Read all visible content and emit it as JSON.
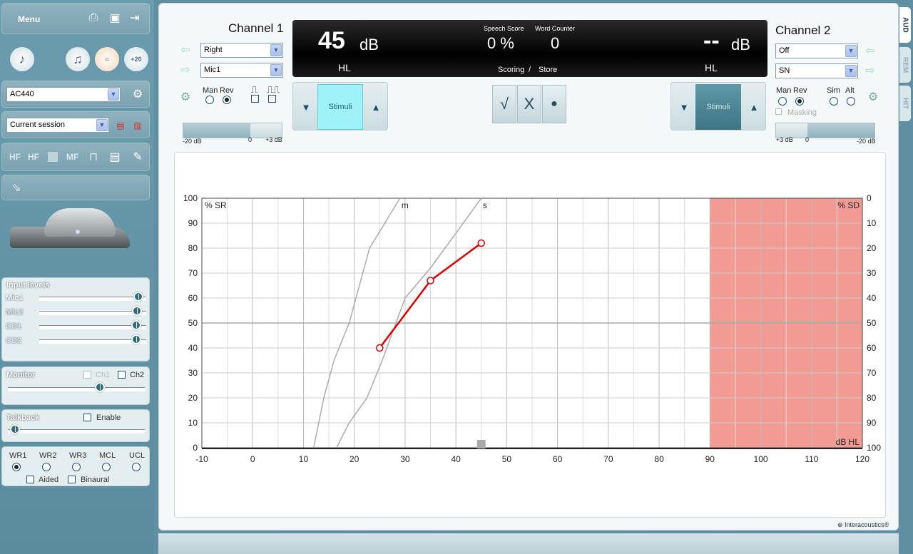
{
  "sidebar": {
    "menu_label": "Menu",
    "transducer": "AC440",
    "session": "Current session",
    "toolbar_labels": [
      "HF",
      "HF",
      "MF"
    ],
    "input_levels": {
      "title": "Input levels",
      "items": [
        {
          "label": "Mic1",
          "level": 0.97
        },
        {
          "label": "Mic2",
          "level": 0.96
        },
        {
          "label": "CD1",
          "level": 0.95
        },
        {
          "label": "CD2",
          "level": 0.95
        }
      ]
    },
    "monitor": {
      "title": "Monitor",
      "ch1": "Ch1",
      "ch2": "Ch2",
      "level": 0.67
    },
    "talkback": {
      "title": "Talkback",
      "enable": "Enable",
      "level": 0.05
    },
    "word_lists": [
      {
        "label": "WR1",
        "selected": true
      },
      {
        "label": "WR2",
        "selected": false
      },
      {
        "label": "WR3",
        "selected": false
      },
      {
        "label": "MCL",
        "selected": false
      },
      {
        "label": "UCL",
        "selected": false
      }
    ],
    "aided": "Aided",
    "binaural": "Binaural"
  },
  "channel1": {
    "title": "Channel 1",
    "output": "Right",
    "input": "Mic1",
    "man": "Man",
    "rev": "Rev",
    "intensity": "45",
    "unit": "dB",
    "hl": "HL",
    "stimuli": "Stimuli",
    "scale": [
      "-20 dB",
      "0",
      "+3 dB"
    ]
  },
  "channel2": {
    "title": "Channel 2",
    "output": "Off",
    "input": "SN",
    "man": "Man",
    "rev": "Rev",
    "sim": "Sim",
    "alt": "Alt",
    "masking": "Masking",
    "intensity": "--",
    "unit": "dB",
    "hl": "HL",
    "stimuli": "Stimuli",
    "scale": [
      "+3 dB",
      "0",
      "-20 dB"
    ]
  },
  "display": {
    "speech_score_label": "Speech Score",
    "speech_score": "0 %",
    "word_counter_label": "Word Counter",
    "word_counter": "0",
    "scoring": "Scoring",
    "slash": "/",
    "store": "Store"
  },
  "score_buttons": {
    "correct": "√",
    "incorrect": "X",
    "record": "●"
  },
  "right_tabs": [
    {
      "label": "AUD",
      "active": true
    },
    {
      "label": "REM",
      "active": false
    },
    {
      "label": "HIT",
      "active": false
    }
  ],
  "brand": "Interacoustics®",
  "colors": {
    "accent": "#5f8fa0",
    "curve": "#e00000",
    "shaded": "#f29b95",
    "stimuli_active": "#9ff2f8"
  },
  "chart_data": {
    "type": "line",
    "y_left_label": "% SR",
    "y_right_label": "% SD",
    "x_unit_label": "dB HL",
    "xlim": [
      -10,
      120
    ],
    "ylim": [
      0,
      100
    ],
    "x_ticks": [
      "-10",
      "0",
      "10",
      "20",
      "30",
      "40",
      "50",
      "60",
      "70",
      "80",
      "90",
      "100",
      "110",
      "120"
    ],
    "y_left_ticks": [
      "100",
      "90",
      "80",
      "70",
      "60",
      "50",
      "40",
      "30",
      "20",
      "10",
      "0"
    ],
    "y_right_ticks": [
      "0",
      "10",
      "20",
      "30",
      "40",
      "50",
      "60",
      "70",
      "80",
      "90",
      "100"
    ],
    "reference_curves": [
      {
        "name": "m",
        "points": [
          [
            12,
            0
          ],
          [
            14,
            20
          ],
          [
            16,
            35
          ],
          [
            19,
            50
          ],
          [
            23,
            80
          ],
          [
            29,
            100
          ]
        ]
      },
      {
        "name": "s",
        "points": [
          [
            16.5,
            0
          ],
          [
            19,
            10
          ],
          [
            22.5,
            20
          ],
          [
            25.5,
            35
          ],
          [
            30,
            60
          ],
          [
            35,
            72
          ],
          [
            45,
            100
          ]
        ]
      }
    ],
    "series": [
      {
        "points": [
          [
            25,
            40
          ],
          [
            35,
            67
          ],
          [
            45,
            82
          ]
        ]
      }
    ],
    "shaded_region": {
      "x_from": 90,
      "x_to": 120,
      "y_from": 0,
      "y_to": 100
    },
    "current_level_marker": 45,
    "grid": true
  }
}
